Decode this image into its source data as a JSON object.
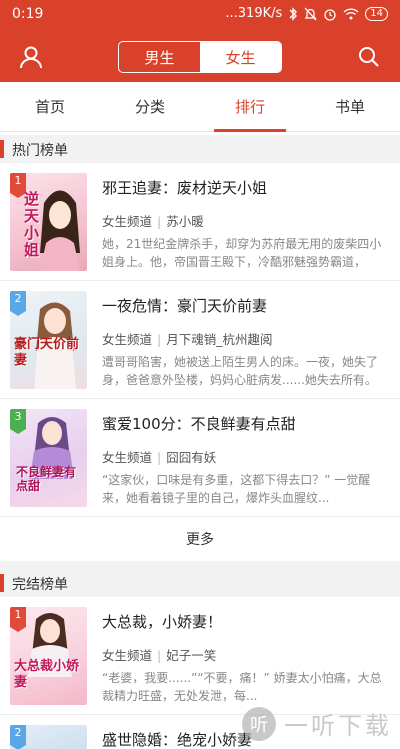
{
  "status_bar": {
    "time": "0:19",
    "network": "...319K/s",
    "battery": "14"
  },
  "header": {
    "segment": [
      "男生",
      "女生"
    ],
    "active_segment": "女生",
    "icons": [
      "user-icon",
      "search-icon"
    ]
  },
  "tabs": [
    "首页",
    "分类",
    "排行",
    "书单"
  ],
  "active_tab": "排行",
  "sections": {
    "hot": "热门榜单",
    "finished": "完结榜单"
  },
  "hot_books": [
    {
      "rank": "1",
      "title": "邪王追妻：废材逆天小姐",
      "channel": "女生频道",
      "author": "苏小暖",
      "desc": "她，21世纪金牌杀手，却穿为苏府最无用的废柴四小姐身上。他，帝国晋王殿下，冷酷邪魅强势霸道，天...",
      "cover_text": "逆天小姐"
    },
    {
      "rank": "2",
      "title": "一夜危情：豪门天价前妻",
      "channel": "女生频道",
      "author": "月下魂销_杭州趣阅",
      "desc": "遭哥哥陷害，她被送上陌生男人的床。一夜，她失了身，爸爸意外坠楼，妈妈心脏病发......她失去所有。几...",
      "cover_text": "豪门天价前妻"
    },
    {
      "rank": "3",
      "title": "蜜爱100分：不良鲜妻有点甜",
      "channel": "女生频道",
      "author": "囧囧有妖",
      "desc": "“这家伙，口味是有多重，这都下得去口？” 一觉醒来，她看着镜子里的自己，爆炸头血腥纹...",
      "cover_text": "不良鲜妻有点甜"
    }
  ],
  "more_label": "更多",
  "finished_books": [
    {
      "rank": "1",
      "title": "大总裁，小娇妻！",
      "channel": "女生频道",
      "author": "妃子一笑",
      "desc": "“老婆，我要......”“不要，痛！” 娇妻太小怕痛，大总裁精力旺盛，无处发泄，每...",
      "cover_text": "大总裁小娇妻"
    },
    {
      "rank": "2",
      "title": "盛世隐婚：绝宠小娇妻"
    }
  ],
  "watermark": "一听下载",
  "colors": {
    "brand": "#d9412b",
    "rank1": "#e04a3a",
    "rank2": "#5aa7e8",
    "rank3": "#4caf50"
  }
}
